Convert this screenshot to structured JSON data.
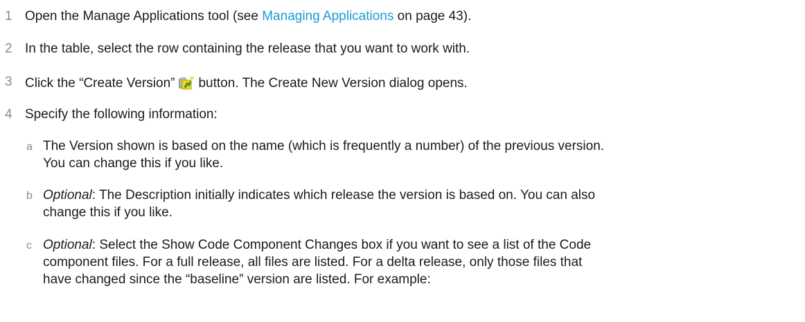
{
  "steps": [
    {
      "num": "1",
      "pre": "Open the Manage Applications tool (see ",
      "link": "Managing Applications",
      "post": " on page 43)."
    },
    {
      "num": "2",
      "text": "In the table, select the row containing the release that you want to work with."
    },
    {
      "num": "3",
      "pre": "Click the “Create Version”",
      "icon": "create-version-icon",
      "post": "button. The Create New Version dialog opens."
    },
    {
      "num": "4",
      "text": "Specify the following information:"
    }
  ],
  "substeps": [
    {
      "letter": "a",
      "line1": "The Version shown is based on the name (which is frequently a number) of the previous version.",
      "line2": "You can change this if you like."
    },
    {
      "letter": "b",
      "prefix": "Optional",
      "line1": ": The Description initially indicates which release the version is based on. You can also",
      "line2": "change this if you like."
    },
    {
      "letter": "c",
      "prefix": "Optional",
      "line1": ": Select the Show Code Component Changes box if you want to see a list of the Code",
      "line2": "component files. For a full release, all files are listed. For a delta release, only those files that",
      "line3": "have changed since the “baseline” version are listed. For example:"
    }
  ]
}
